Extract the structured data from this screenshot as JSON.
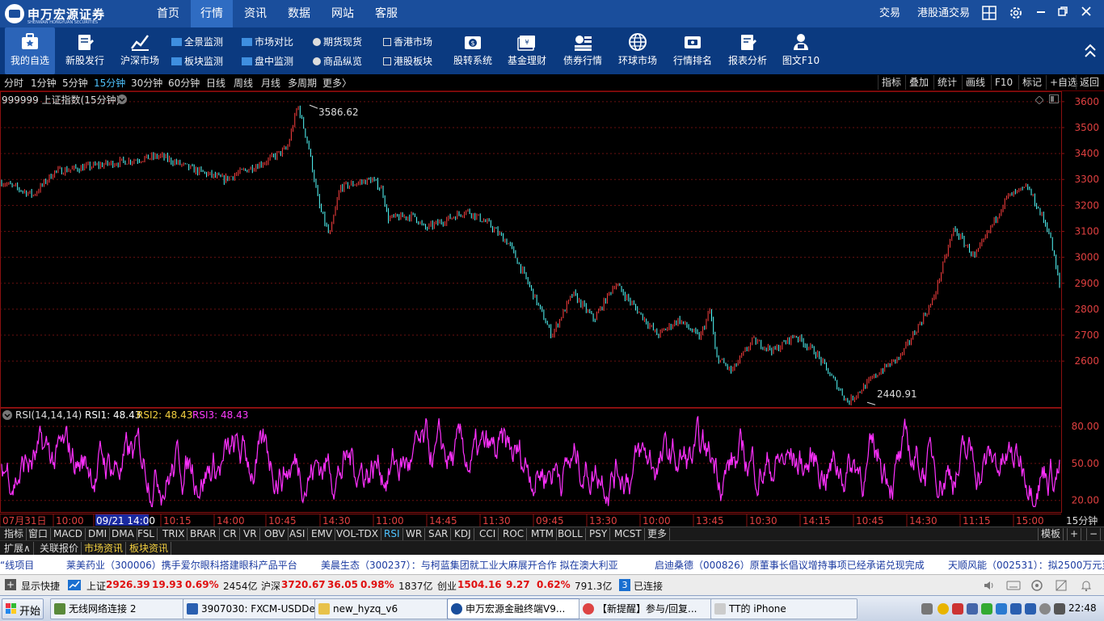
{
  "app": {
    "brand": "申万宏源证券",
    "brand_en": "SHENWAN HONGYUAN SECURITIES",
    "nav": [
      "首页",
      "行情",
      "资讯",
      "数据",
      "网站",
      "客服"
    ],
    "nav_active": 1,
    "right_links": [
      "交易",
      "港股通交易"
    ]
  },
  "toolbar": {
    "big": [
      {
        "label": "我的自选",
        "icon": "favorites-icon"
      },
      {
        "label": "新股发行",
        "icon": "ipo-icon"
      },
      {
        "label": "沪深市场",
        "icon": "market-icon"
      },
      {
        "label": "股转系统",
        "icon": "share-transfer-icon"
      },
      {
        "label": "基金理财",
        "icon": "fund-icon"
      },
      {
        "label": "债券行情",
        "icon": "bond-icon"
      },
      {
        "label": "环球市场",
        "icon": "globe-icon"
      },
      {
        "label": "行情排名",
        "icon": "ranking-icon"
      },
      {
        "label": "报表分析",
        "icon": "report-icon"
      },
      {
        "label": "图文F10",
        "icon": "f10-icon"
      }
    ],
    "mini": [
      {
        "label": "全景监测"
      },
      {
        "label": "板块监测"
      },
      {
        "label": "市场对比"
      },
      {
        "label": "盘中监测"
      },
      {
        "label": "期货现货"
      },
      {
        "label": "商品纵览"
      },
      {
        "label": "香港市场"
      },
      {
        "label": "港股板块"
      }
    ]
  },
  "periods": [
    "分时",
    "1分钟",
    "5分钟",
    "15分钟",
    "30分钟",
    "60分钟",
    "日线",
    "周线",
    "月线",
    "多周期",
    "更多〉"
  ],
  "period_active": 3,
  "right_tools": [
    "指标",
    "叠加",
    "统计",
    "画线",
    "F10",
    "标记",
    "+自选",
    "返回"
  ],
  "chart": {
    "title": "999999 上证指数(15分钟)",
    "high_label": "3586.62",
    "low_label": "2440.91",
    "period_label": "15分钟",
    "rsi_title": "RSI(14,14,14)",
    "rsi1": "RSI1: 48.43",
    "rsi2": "RSI2: 48.43",
    "rsi3": "RSI3: 48.43"
  },
  "chart_data": {
    "type": "line",
    "title": "999999 上证指数(15分钟)",
    "y_ticks": [
      3600,
      3500,
      3400,
      3300,
      3200,
      3100,
      3000,
      2900,
      2800,
      2700,
      2600
    ],
    "ylim": [
      2420,
      3640
    ],
    "x_labels": [
      "07月31日",
      "10:00",
      "09/21 14:00",
      "10:15",
      "14:00",
      "10:45",
      "14:30",
      "11:00",
      "14:45",
      "11:30",
      "09:45",
      "13:30",
      "10:00",
      "13:45",
      "10:30",
      "14:15",
      "10:45",
      "14:30",
      "11:15",
      "15:00"
    ],
    "series_keypoints": [
      [
        0,
        3290
      ],
      [
        3,
        3240
      ],
      [
        5,
        3330
      ],
      [
        10,
        3360
      ],
      [
        15,
        3390
      ],
      [
        18,
        3340
      ],
      [
        21,
        3300
      ],
      [
        25,
        3370
      ],
      [
        27,
        3420
      ],
      [
        28,
        3586.62
      ],
      [
        29,
        3430
      ],
      [
        30,
        3200
      ],
      [
        31,
        3080
      ],
      [
        32,
        3270
      ],
      [
        35,
        3300
      ],
      [
        36,
        3260
      ],
      [
        36.5,
        3150
      ],
      [
        39,
        3160
      ],
      [
        40,
        3110
      ],
      [
        44,
        3180
      ],
      [
        46,
        3130
      ],
      [
        48,
        3050
      ],
      [
        50,
        2880
      ],
      [
        52,
        2700
      ],
      [
        54,
        2860
      ],
      [
        56,
        2760
      ],
      [
        58,
        2900
      ],
      [
        60,
        2800
      ],
      [
        62,
        2700
      ],
      [
        64,
        2760
      ],
      [
        66,
        2690
      ],
      [
        67,
        2800
      ],
      [
        67.5,
        2620
      ],
      [
        69,
        2560
      ],
      [
        71,
        2680
      ],
      [
        73,
        2640
      ],
      [
        75,
        2700
      ],
      [
        77,
        2630
      ],
      [
        80,
        2440.91
      ],
      [
        83,
        2560
      ],
      [
        85,
        2620
      ],
      [
        88,
        2830
      ],
      [
        90,
        3110
      ],
      [
        92,
        3000
      ],
      [
        95,
        3230
      ],
      [
        97,
        3270
      ],
      [
        99,
        3100
      ],
      [
        100,
        2890
      ]
    ],
    "high": 3586.62,
    "low": 2440.91,
    "rsi": {
      "y_ticks": [
        80.0,
        50.0,
        20.0
      ],
      "y_tick_labels": [
        "80.00",
        "50.00",
        "20.00"
      ],
      "ylim": [
        10,
        95
      ],
      "RSI1": 48.43,
      "RSI2": 48.43,
      "RSI3": 48.43
    }
  },
  "indicators": [
    "指标",
    "窗口",
    "MACD",
    "DMI",
    "DMA",
    "FSL",
    "TRIX",
    "BRAR",
    "CR",
    "VR",
    "OBV",
    "ASI",
    "EMV",
    "VOL-TDX",
    "RSI",
    "WR",
    "SAR",
    "KDJ",
    "CCI",
    "ROC",
    "MTM",
    "BOLL",
    "PSY",
    "MCST",
    "更多"
  ],
  "indicator_active": 14,
  "template_label": "模板",
  "ext_tabs": [
    "扩展∧",
    "关联报价",
    "市场资讯",
    "板块资讯"
  ],
  "ticker": [
    "“线项目",
    "莱美药业（300006）携手爱尔眼科搭建眼科产品平台",
    "美晨生态（300237）：与柯蓝集团就工业大麻展开合作  拟在澳大利亚",
    "启迪桑德（000826）原董事长倡议增持事项已经承诺兑现完成",
    "天顺风能（002531）：拟2500万元至"
  ],
  "status": {
    "shortcut": "显示快捷",
    "sh_label": "上证",
    "sh_value": "2926.39",
    "sh_change": "19.93",
    "sh_pct": "0.69%",
    "sh_amount": "2454亿",
    "sz_label": "沪深",
    "sz_value": "3720.67",
    "sz_change": "36.05",
    "sz_pct": "0.98%",
    "sz_amount": "1837亿",
    "cy_label": "创业",
    "cy_value": "1504.16",
    "cy_change": "9.27",
    "cy_pct": "0.62%",
    "cy_amount": "791.3亿",
    "conn_count": "3",
    "conn_label": "已连接"
  },
  "taskbar": {
    "start": "开始",
    "tasks": [
      {
        "label": "无线网络连接 2"
      },
      {
        "label": "3907030: FXCM-USDDe..."
      },
      {
        "label": "new_hyzq_v6"
      },
      {
        "label": "申万宏源金融终端V9..."
      },
      {
        "label": "【新提醒】参与/回复..."
      },
      {
        "label": "TT的 iPhone"
      }
    ],
    "task_active": 3,
    "clock": "22:48"
  }
}
